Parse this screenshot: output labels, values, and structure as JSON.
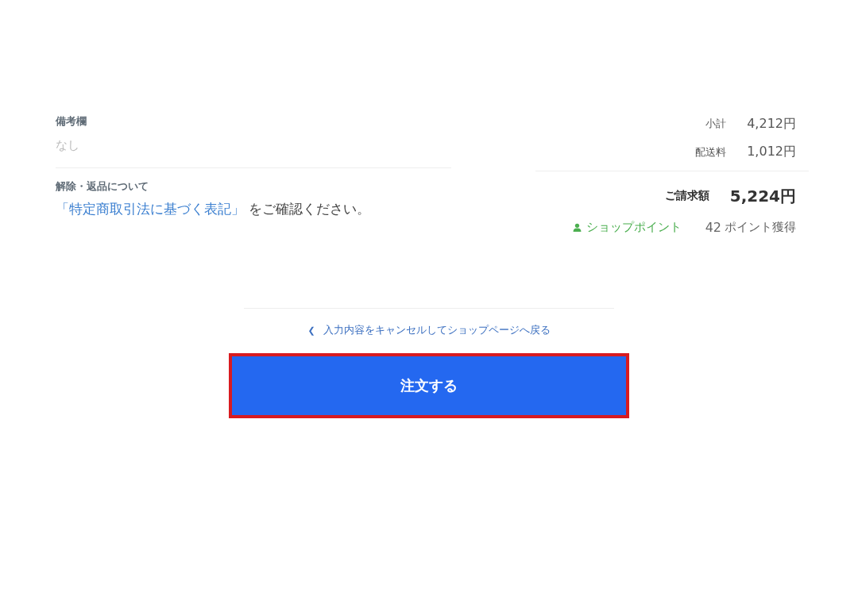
{
  "remarks": {
    "label": "備考欄",
    "value": "なし"
  },
  "returns": {
    "label": "解除・返品について",
    "link": "「特定商取引法に基づく表記」",
    "text": " をご確認ください。"
  },
  "summary": {
    "rows": [
      {
        "label": "小計",
        "value": "4,212円"
      },
      {
        "label": "配送料",
        "value": "1,012円"
      }
    ],
    "total": {
      "label": "ご請求額",
      "value": "5,224円"
    },
    "points": {
      "label": "ショップポイント",
      "number": "42",
      "unit": "ポイント獲得"
    }
  },
  "back_link": {
    "icon": "❮",
    "label": "入力内容をキャンセルしてショップページへ戻る"
  },
  "order_button": {
    "label": "注文する",
    "highlighted": true
  }
}
